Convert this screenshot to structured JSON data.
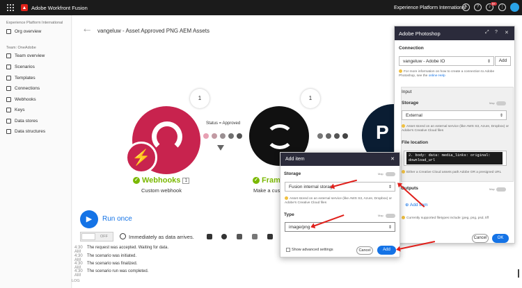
{
  "topbar": {
    "app_name": "Adobe Workfront Fusion",
    "org_name": "Experience Platform International",
    "notif_count": "9+"
  },
  "sidebar": {
    "org_section": "Experience Platform International",
    "org_overview": "Org overview",
    "team_section": "Team: OneAdobe",
    "items": [
      "Team overview",
      "Scenarios",
      "Templates",
      "Connections",
      "Webhooks",
      "Keys",
      "Data stores",
      "Data structures"
    ]
  },
  "scenario": {
    "title": "vangeluw - Asset Approved PNG AEM Assets"
  },
  "nodes": {
    "webhook": {
      "name": "Webhooks",
      "count": "1",
      "subtitle": "Custom webhook",
      "bubble": "1"
    },
    "frame": {
      "name": "Fram",
      "subtitle": "Make a cust",
      "bubble": "1"
    },
    "filter_label": "Status = Approved"
  },
  "run": {
    "label": "Run once",
    "toggle": "OFF",
    "schedule": "Immediately as data arrives."
  },
  "log": [
    {
      "time": "4:30 AM",
      "text": "The request was accepted. Waiting for data."
    },
    {
      "time": "4:30 AM",
      "text": "The scenario was initiated."
    },
    {
      "time": "4:30 AM",
      "text": "The scenario was finalized."
    },
    {
      "time": "4:30 AM",
      "text": "The scenario run was completed."
    }
  ],
  "log_label": "LOG",
  "panel": {
    "title": "Adobe Photoshop",
    "connection_label": "Connection",
    "connection_value": "vangeluw - Adobe IO",
    "add_button": "Add",
    "connection_note_pre": "For more information on how to create a connection to Adobe Photoshop, see the",
    "connection_note_link": "online Help",
    "input_label": "Input",
    "storage_label": "Storage",
    "storage_value": "External",
    "storage_note": "Asset stored on an external service (like AWS S3, Azure, Dropbox) or Adobe's Creative Cloud files",
    "file_location_label": "File location",
    "file_location_value": "2. body: data: media_links: original: download_url",
    "file_location_note": "Either a Creative Cloud assets path Adobe OR a presigned URL",
    "outputs_label": "Outputs",
    "add_item": "Add item",
    "outputs_note": "Currently supported filetypes include: jpeg, png, psd, tiff",
    "map_label": "Map",
    "cancel": "Cancel",
    "ok": "OK"
  },
  "modal": {
    "title": "Add item",
    "storage_label": "Storage",
    "storage_value": "Fusion internal storage",
    "storage_note": "Asset stored on an external service (like AWS S3, Azure, Dropbox) or Adobe's Creative Cloud files",
    "type_label": "Type",
    "type_value": "image/png",
    "show_advanced": "Show advanced settings",
    "cancel": "Cancel",
    "add": "Add",
    "map_label": "Map"
  },
  "colors": {
    "accent": "#1473e6",
    "webhook": "#c8234e",
    "success": "#7ab800",
    "annotation": "#e0201b",
    "header": "#2b2b3b"
  }
}
